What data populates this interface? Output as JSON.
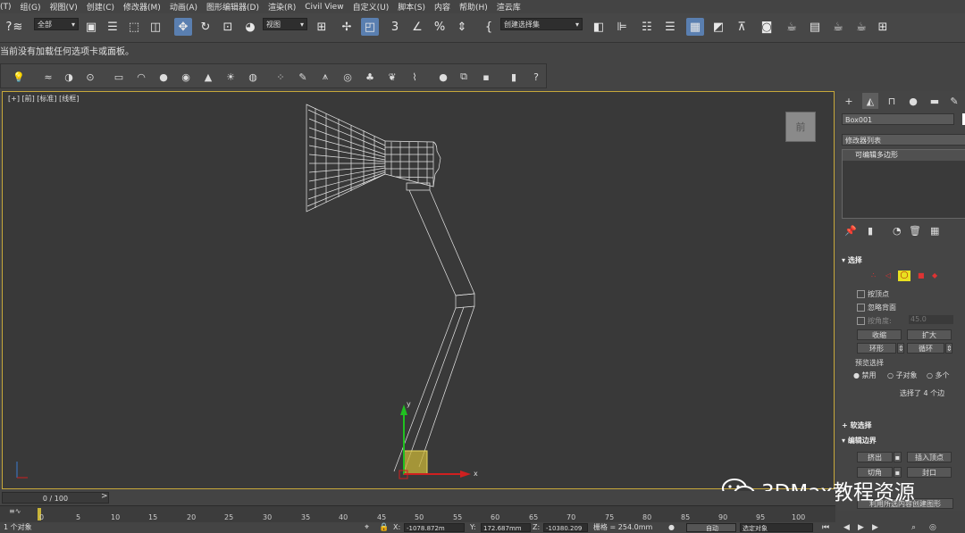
{
  "menu": {
    "items": [
      "(T)",
      "组(G)",
      "视图(V)",
      "创建(C)",
      "修改器(M)",
      "动画(A)",
      "图形编辑器(D)",
      "渲染(R)",
      "Civil View",
      "自定义(U)",
      "脚本(S)",
      "内容",
      "帮助(H)",
      "渲云库"
    ]
  },
  "toolbar": {
    "selection_filter": "全部",
    "reference_coord": "视图",
    "selection_set": "创建选择集",
    "snap_label": "3",
    "percent_icon": "%"
  },
  "notice": "当前没有加载任何选项卡或面板。",
  "viewport": {
    "label_plus": "[+]",
    "label_view": "[前]",
    "label_shading": "[标准]",
    "label_style": "[线框]",
    "viewcube_label": "前",
    "axis_x": "x",
    "axis_y": "y"
  },
  "panel": {
    "object_name": "Box001",
    "modifier_list": "修改器列表",
    "stack_item": "可编辑多边形",
    "selection_title": "选择",
    "by_vertex": "按顶点",
    "ignore_backface": "忽略背面",
    "by_angle": "按角度:",
    "angle_value": "45.0",
    "shrink": "收缩",
    "grow": "扩大",
    "ring": "环形",
    "loop": "循环",
    "preview_title": "预览选择",
    "preview_off": "禁用",
    "preview_subobj": "子对象",
    "preview_multi": "多个",
    "selected_info": "选择了 4 个边",
    "soft_select": "软选择",
    "edit_edges": "编辑边界",
    "extrude": "挤出",
    "insert_vertex": "插入顶点",
    "chamfer": "切角",
    "cap": "封口",
    "create_shape": "利用所选内容创建图形"
  },
  "timeline": {
    "frame": "0 / 100",
    "ticks": [
      "5",
      "10",
      "15",
      "20",
      "25",
      "30",
      "35",
      "40",
      "45",
      "50",
      "55",
      "60",
      "65",
      "70",
      "75",
      "80",
      "85",
      "90",
      "95",
      "100"
    ],
    "ruler_start": "0"
  },
  "status": {
    "objects": "1 个对象",
    "x_label": "X:",
    "x_value": "-1078.872m",
    "y_label": "Y:",
    "y_value": "172.687mm",
    "z_label": "Z:",
    "z_value": "-10380.209",
    "grid_label": "栅格 = 254.0mm",
    "auto_key": "自动",
    "selected_obj": "选定对象"
  },
  "watermark": "3DMax教程资源",
  "colors": {
    "viewport_border": "#c7a83a",
    "active_button": "#5a7fb0",
    "gizmo_x": "#d02020",
    "gizmo_y": "#20c020",
    "gizmo_box": "#c8b438"
  }
}
